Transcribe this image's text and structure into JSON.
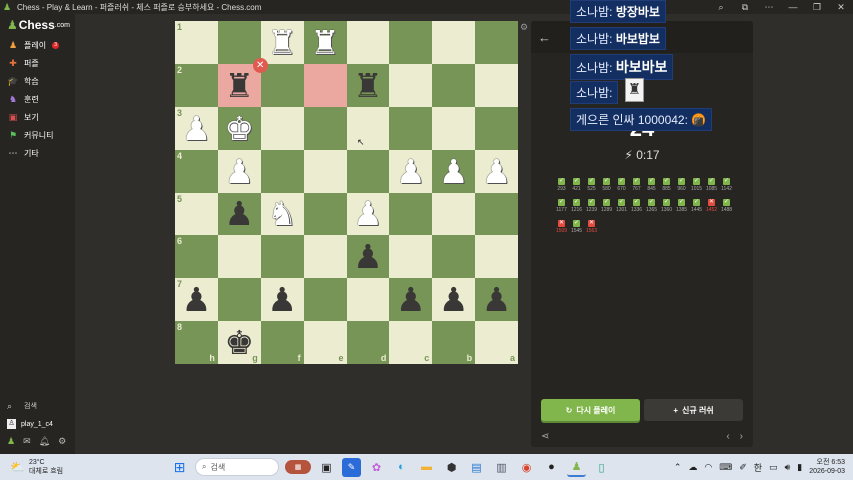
{
  "window": {
    "title": "Chess - Play & Learn - 퍼즐러쉬 - 체스 퍼즐로 승부하세요 - Chess.com",
    "controls": [
      "⌕",
      "⧉",
      "⋯",
      "—",
      "❐",
      "✕"
    ]
  },
  "sidebar": {
    "brand": "Chess",
    "brand_suffix": ".com",
    "items": [
      {
        "label": "플레이",
        "icon": "play-icon",
        "glyph": "♟",
        "badge": "3"
      },
      {
        "label": "퍼즐",
        "icon": "puzzle-icon",
        "glyph": "✚"
      },
      {
        "label": "학습",
        "icon": "learn-icon",
        "glyph": "🎓"
      },
      {
        "label": "훈련",
        "icon": "train-icon",
        "glyph": "♞"
      },
      {
        "label": "보기",
        "icon": "watch-icon",
        "glyph": "▣"
      },
      {
        "label": "커뮤니티",
        "icon": "community-icon",
        "glyph": "⚑"
      },
      {
        "label": "기타",
        "icon": "more-icon",
        "glyph": "⋯"
      }
    ],
    "search_label": "검색",
    "user_label": "play_1_c4"
  },
  "board": {
    "rank_labels": [
      "1",
      "2",
      "3",
      "4",
      "5",
      "6",
      "7",
      "8"
    ],
    "file_labels": [
      "h",
      "g",
      "f",
      "e",
      "d",
      "c",
      "b",
      "a"
    ],
    "squares": [
      [
        "",
        "",
        "wR",
        "wR",
        "",
        "",
        "",
        ""
      ],
      [
        "",
        "bR",
        "",
        "",
        "bR",
        "",
        "",
        ""
      ],
      [
        "wP",
        "wK",
        "",
        "",
        "",
        "",
        "",
        ""
      ],
      [
        "",
        "wP",
        "",
        "",
        "",
        "wP",
        "wP",
        "wP"
      ],
      [
        "",
        "bP",
        "wN",
        "",
        "wP",
        "",
        "",
        ""
      ],
      [
        "",
        "",
        "",
        "",
        "bP",
        "",
        "",
        ""
      ],
      [
        "bP",
        "",
        "bP",
        "",
        "",
        "bP",
        "bP",
        "bP"
      ],
      [
        "",
        "bK",
        "",
        "",
        "",
        "",
        "",
        ""
      ]
    ],
    "highlight": [
      [
        1,
        1
      ],
      [
        1,
        3
      ]
    ],
    "wrong_marker": "✕"
  },
  "panel": {
    "back_icon": "←",
    "score": "24",
    "timer": "0:17",
    "results": [
      {
        "ok": true,
        "n": "293"
      },
      {
        "ok": true,
        "n": "421"
      },
      {
        "ok": true,
        "n": "525"
      },
      {
        "ok": true,
        "n": "580"
      },
      {
        "ok": true,
        "n": "670"
      },
      {
        "ok": true,
        "n": "767"
      },
      {
        "ok": true,
        "n": "845"
      },
      {
        "ok": true,
        "n": "885"
      },
      {
        "ok": true,
        "n": "960"
      },
      {
        "ok": true,
        "n": "1015"
      },
      {
        "ok": true,
        "n": "1085"
      },
      {
        "ok": true,
        "n": "1142"
      },
      {
        "ok": true,
        "n": "1177"
      },
      {
        "ok": true,
        "n": "1216"
      },
      {
        "ok": true,
        "n": "1239"
      },
      {
        "ok": true,
        "n": "1289"
      },
      {
        "ok": true,
        "n": "1301"
      },
      {
        "ok": true,
        "n": "1336"
      },
      {
        "ok": true,
        "n": "1365"
      },
      {
        "ok": true,
        "n": "1360"
      },
      {
        "ok": true,
        "n": "1385"
      },
      {
        "ok": true,
        "n": "1445"
      },
      {
        "ok": false,
        "n": "1452"
      },
      {
        "ok": true,
        "n": "1488"
      },
      {
        "ok": false,
        "n": "1509"
      },
      {
        "ok": true,
        "n": "1545"
      },
      {
        "ok": false,
        "n": "1563"
      }
    ],
    "retry_label": "다시 플레이",
    "new_label": "신규 러쉬"
  },
  "chat": [
    {
      "name": "소나밤:",
      "msg": "방장바보"
    },
    {
      "name": "소나밤:",
      "msg": "바보밥보"
    },
    {
      "name": "소나밤:",
      "msg": "바보바보"
    },
    {
      "name": "소나밤:",
      "msg": ""
    },
    {
      "name": "게으른 인싸 1000042:",
      "msg": "🍘"
    }
  ],
  "taskbar": {
    "temp": "23°C",
    "weather_text": "대체로 흐림",
    "search_placeholder": "검색",
    "ime": "한",
    "time": "오전 6:53",
    "date": "2026-09-03"
  }
}
